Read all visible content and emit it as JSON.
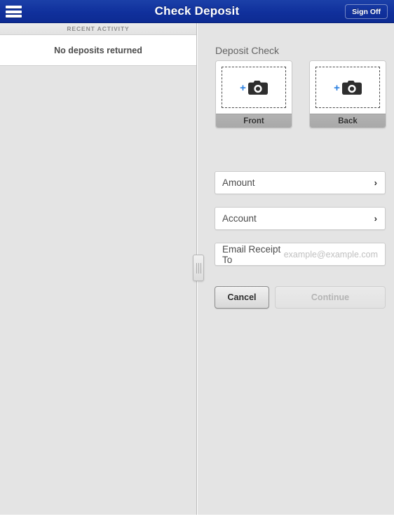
{
  "navbar": {
    "menu_icon": "hamburger-menu-icon",
    "title": "Check Deposit",
    "signoff_label": "Sign Off"
  },
  "left_panel": {
    "section_header": "RECENT ACTIVITY",
    "empty_message": "No deposits returned"
  },
  "right_panel": {
    "title": "Deposit Check",
    "split_handle_icon": "drag-handle-icon",
    "captures": [
      {
        "label": "Front",
        "plus": "+",
        "camera_icon": "camera-icon"
      },
      {
        "label": "Back",
        "plus": "+",
        "camera_icon": "camera-icon"
      }
    ],
    "fields": [
      {
        "label": "Amount",
        "chevron": "›",
        "value": "",
        "placeholder": ""
      },
      {
        "label": "Account",
        "chevron": "›",
        "value": "",
        "placeholder": ""
      },
      {
        "label": "Email Receipt To",
        "value": "",
        "placeholder": "example@example.com"
      }
    ],
    "buttons": {
      "cancel_label": "Cancel",
      "continue_label": "Continue"
    }
  },
  "colors": {
    "navbar_blue": "#10309c",
    "panel_gray": "#e4e4e4",
    "accent_blue": "#2a7fe0",
    "capture_label_gray": "#aeaeae",
    "disabled_text": "#b4b4b4"
  }
}
